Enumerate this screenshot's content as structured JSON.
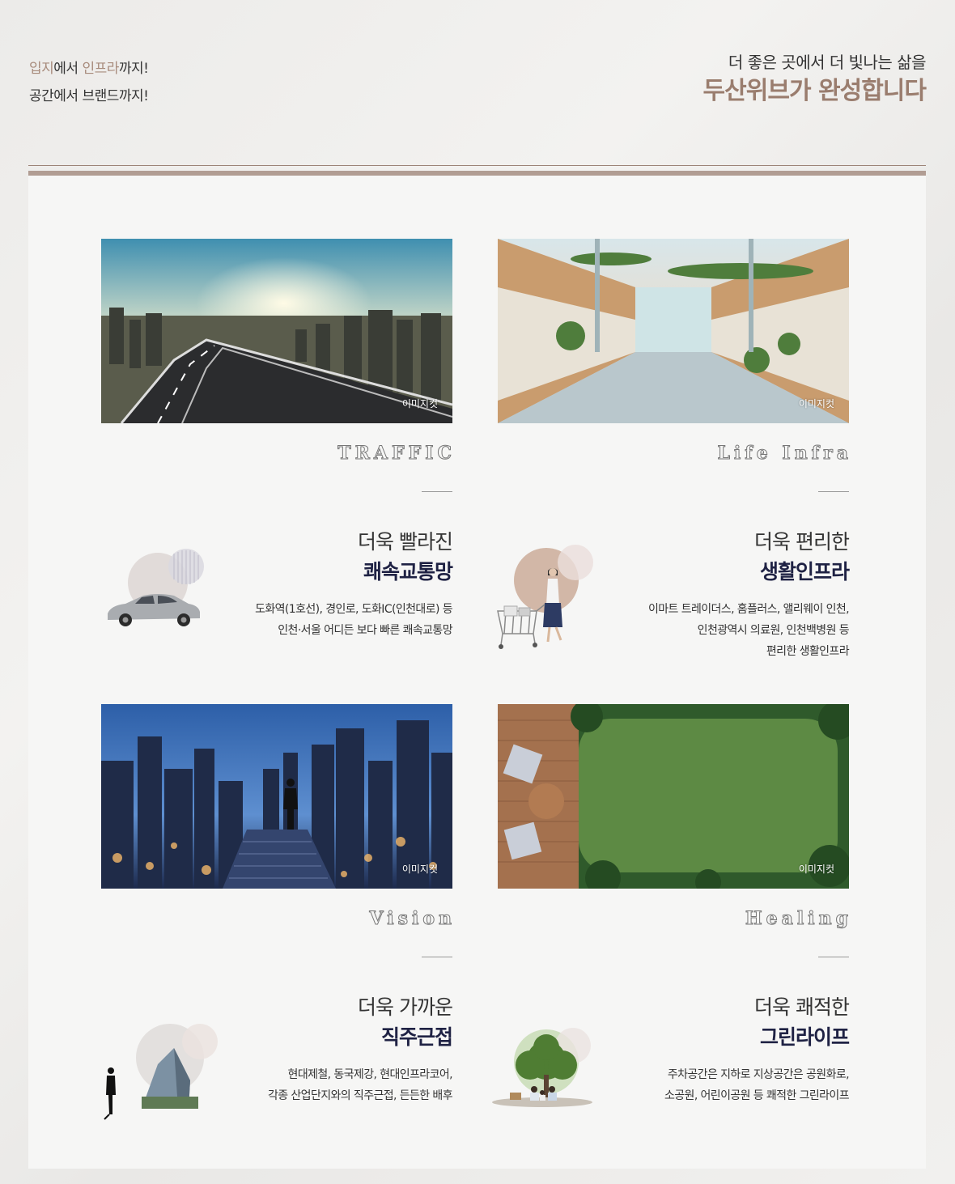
{
  "header": {
    "left_line1_a": "입지",
    "left_line1_b": "에서 ",
    "left_line1_c": "인프라",
    "left_line1_d": "까지!",
    "left_line2": "공간에서 브랜드까지!",
    "right_sub": "더 좋은 곳에서 더 빛나는 삶을",
    "right_main": "두산위브가 완성합니다"
  },
  "cut_label": "이미지컷",
  "cards": [
    {
      "eng": "TRAFFIC",
      "title1": "더욱 빨라진",
      "title2": "쾌속교통망",
      "desc": [
        "도화역(1호선), 경인로, 도화IC(인천대로) 등",
        "인천·서울 어디든 보다 빠른 쾌속교통망"
      ]
    },
    {
      "eng": "Life Infra",
      "title1": "더욱 편리한",
      "title2": "생활인프라",
      "desc": [
        "이마트 트레이더스, 홈플러스, 앨리웨이 인천,",
        "인천광역시 의료원, 인천백병원 등",
        "편리한 생활인프라"
      ]
    },
    {
      "eng": "Vision",
      "title1": "더욱 가까운",
      "title2": "직주근접",
      "desc": [
        "현대제철, 동국제강, 현대인프라코어,",
        "각종 산업단지와의 직주근접, 든든한 배후"
      ]
    },
    {
      "eng": "Healing",
      "title1": "더욱 쾌적한",
      "title2": "그린라이프",
      "desc": [
        "주차공간은 지하로 지상공간은 공원화로,",
        "소공원, 어린이공원 등 쾌적한 그린라이프"
      ]
    }
  ],
  "colors": {
    "accent": "#a88b7c",
    "title_navy": "#1f2244",
    "rule": "#b19d93"
  }
}
